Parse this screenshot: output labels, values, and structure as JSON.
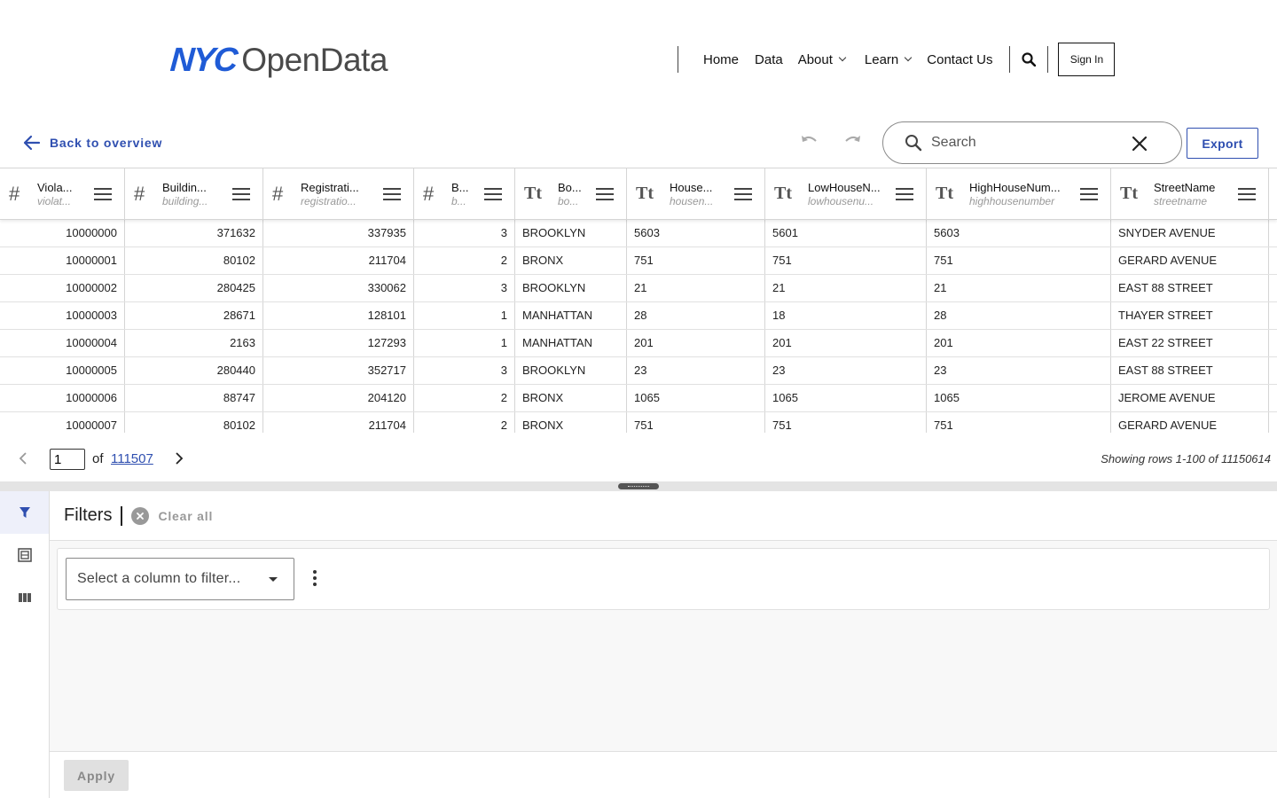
{
  "header": {
    "logo_brand": "NYC",
    "logo_product": "OpenData",
    "nav": [
      {
        "label": "Home",
        "dropdown": false
      },
      {
        "label": "Data",
        "dropdown": false
      },
      {
        "label": "About",
        "dropdown": true
      },
      {
        "label": "Learn",
        "dropdown": true
      },
      {
        "label": "Contact Us",
        "dropdown": false
      }
    ],
    "search_icon": "search-icon",
    "sign_in_label": "Sign In"
  },
  "toolbar": {
    "back_label": "Back to overview",
    "search_placeholder": "Search",
    "export_label": "Export"
  },
  "grid": {
    "columns": [
      {
        "type": "#",
        "name": "Viola...",
        "field": "violat..."
      },
      {
        "type": "#",
        "name": "Buildin...",
        "field": "building..."
      },
      {
        "type": "#",
        "name": "Registrati...",
        "field": "registratio..."
      },
      {
        "type": "#",
        "name": "B...",
        "field": "b..."
      },
      {
        "type": "Tt",
        "name": "Bo...",
        "field": "bo..."
      },
      {
        "type": "Tt",
        "name": "House...",
        "field": "housen..."
      },
      {
        "type": "Tt",
        "name": "LowHouseN...",
        "field": "lowhousenu..."
      },
      {
        "type": "Tt",
        "name": "HighHouseNum...",
        "field": "highhousenumber"
      },
      {
        "type": "Tt",
        "name": "StreetName",
        "field": "streetname"
      }
    ],
    "rows": [
      [
        "10000000",
        "371632",
        "337935",
        "3",
        "BROOKLYN",
        "5603",
        "5601",
        "5603",
        "SNYDER AVENUE"
      ],
      [
        "10000001",
        "80102",
        "211704",
        "2",
        "BRONX",
        "751",
        "751",
        "751",
        "GERARD AVENUE"
      ],
      [
        "10000002",
        "280425",
        "330062",
        "3",
        "BROOKLYN",
        "21",
        "21",
        "21",
        "EAST 88 STREET"
      ],
      [
        "10000003",
        "28671",
        "128101",
        "1",
        "MANHATTAN",
        "28",
        "18",
        "28",
        "THAYER STREET"
      ],
      [
        "10000004",
        "2163",
        "127293",
        "1",
        "MANHATTAN",
        "201",
        "201",
        "201",
        "EAST 22 STREET"
      ],
      [
        "10000005",
        "280440",
        "352717",
        "3",
        "BROOKLYN",
        "23",
        "23",
        "23",
        "EAST 88 STREET"
      ],
      [
        "10000006",
        "88747",
        "204120",
        "2",
        "BRONX",
        "1065",
        "1065",
        "1065",
        "JEROME AVENUE"
      ],
      [
        "10000007",
        "80102",
        "211704",
        "2",
        "BRONX",
        "751",
        "751",
        "751",
        "GERARD AVENUE"
      ]
    ]
  },
  "pager": {
    "page_value": "1",
    "of_label": "of",
    "total_pages": "111507",
    "status": "Showing rows 1-100 of 11150614"
  },
  "filters": {
    "title": "Filters",
    "clear_all_label": "Clear all",
    "column_select_placeholder": "Select a column to filter...",
    "apply_label": "Apply"
  },
  "colors": {
    "brand_blue": "#1f5bd6",
    "link_blue": "#2f4fb0"
  }
}
